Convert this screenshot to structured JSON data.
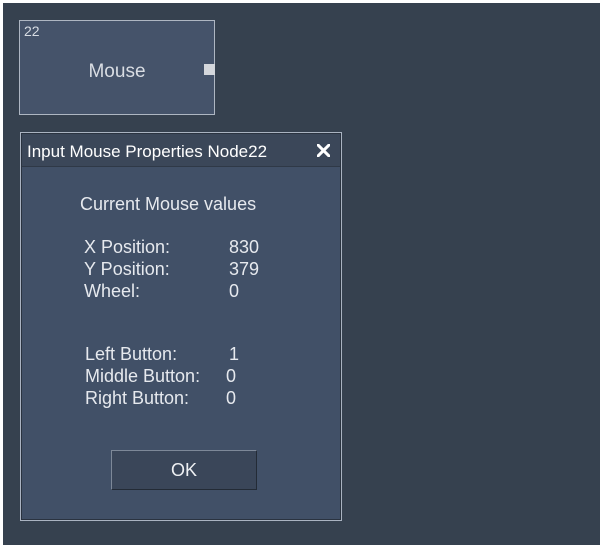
{
  "node": {
    "id": "22",
    "label": "Mouse"
  },
  "dialog": {
    "title": "Input Mouse Properties Node22",
    "close_icon": "close-icon",
    "section_title": "Current Mouse values",
    "position_rows": [
      {
        "label": "X Position:",
        "value": "830"
      },
      {
        "label": "Y Position:",
        "value": "379"
      },
      {
        "label": "Wheel:",
        "value": "0"
      }
    ],
    "button_rows": [
      {
        "label": "Left Button:",
        "value": "1"
      },
      {
        "label": "Middle Button:",
        "value": "0"
      },
      {
        "label": "Right Button:",
        "value": "0"
      }
    ],
    "ok_label": "OK"
  },
  "colors": {
    "canvas": "#36414f",
    "node_fill": "#45536a",
    "dialog_fill": "#415067",
    "text": "#e6e9ee"
  }
}
